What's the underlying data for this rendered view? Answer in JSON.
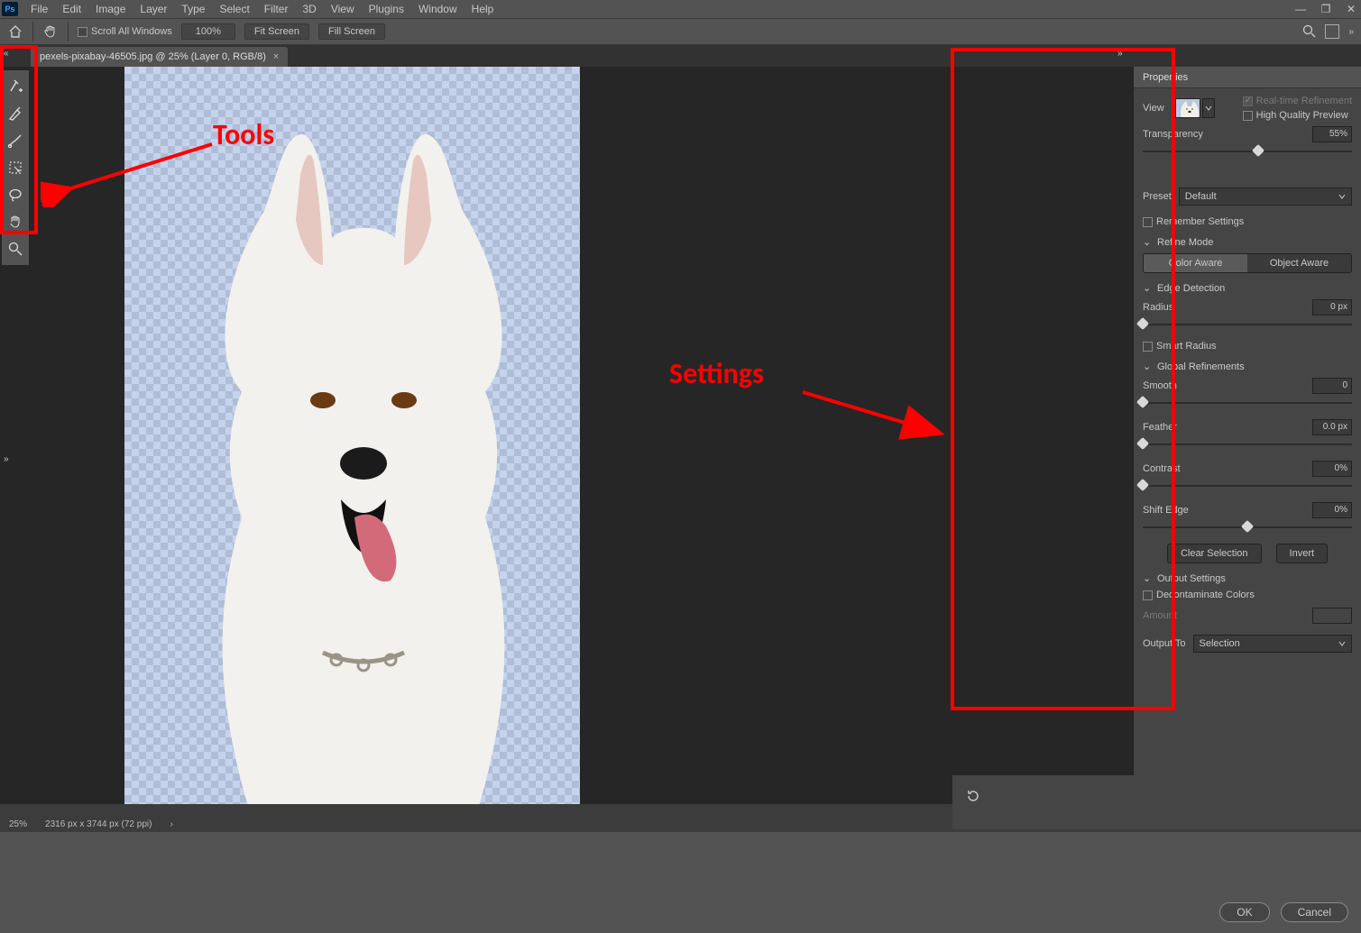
{
  "app_logo_text": "Ps",
  "menu": [
    "File",
    "Edit",
    "Image",
    "Layer",
    "Type",
    "Select",
    "Filter",
    "3D",
    "View",
    "Plugins",
    "Window",
    "Help"
  ],
  "options": {
    "scroll_all": "Scroll All Windows",
    "zoom": "100%",
    "fit": "Fit Screen",
    "fill": "Fill Screen"
  },
  "doc_tab": "pexels-pixabay-46505.jpg @ 25% (Layer 0, RGB/8)",
  "status": {
    "zoom": "25%",
    "dims": "2316 px x 3744 px (72 ppi)"
  },
  "annotations": {
    "tools": "Tools",
    "settings": "Settings"
  },
  "panel": {
    "title": "Properties",
    "view_label": "View",
    "realtime": "Real-time Refinement",
    "hq_preview": "High Quality Preview",
    "transparency": {
      "label": "Transparency",
      "value": "55%",
      "pos": 55
    },
    "preset": {
      "label": "Preset",
      "value": "Default"
    },
    "remember": "Remember Settings",
    "refine_mode": {
      "head": "Refine Mode",
      "color": "Color Aware",
      "object": "Object Aware"
    },
    "edge_det": {
      "head": "Edge Detection",
      "radius_label": "Radius",
      "radius_value": "0 px",
      "radius_pos": 0,
      "smart": "Smart Radius"
    },
    "global": {
      "head": "Global Refinements",
      "smooth": {
        "label": "Smooth",
        "value": "0",
        "pos": 0
      },
      "feather": {
        "label": "Feather",
        "value": "0.0 px",
        "pos": 0
      },
      "contrast": {
        "label": "Contrast",
        "value": "0%",
        "pos": 0
      },
      "shift": {
        "label": "Shift Edge",
        "value": "0%",
        "pos": 50
      },
      "clear": "Clear Selection",
      "invert": "Invert"
    },
    "output": {
      "head": "Output Settings",
      "decon": "Decontaminate Colors",
      "amount": "Amount",
      "output_to": "Output To",
      "output_to_value": "Selection"
    }
  },
  "footer": {
    "ok": "OK",
    "cancel": "Cancel"
  }
}
